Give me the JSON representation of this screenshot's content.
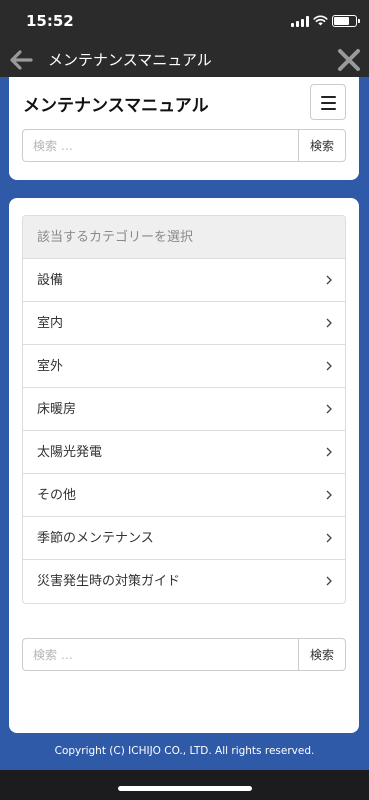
{
  "status_bar": {
    "time": "15:52"
  },
  "nav_bar": {
    "title": "メンテナンスマニュアル"
  },
  "header": {
    "site_title": "メンテナンスマニュアル",
    "search": {
      "placeholder": "検索 …",
      "button_label": "検索"
    }
  },
  "categories": {
    "header": "該当するカテゴリーを選択",
    "items": [
      {
        "label": "設備"
      },
      {
        "label": "室内"
      },
      {
        "label": "室外"
      },
      {
        "label": "床暖房"
      },
      {
        "label": "太陽光発電"
      },
      {
        "label": "その他"
      },
      {
        "label": "季節のメンテナンス"
      },
      {
        "label": "災害発生時の対策ガイド"
      }
    ]
  },
  "bottom_search": {
    "placeholder": "検索 …",
    "button_label": "検索"
  },
  "footer": {
    "copyright": "Copyright (C) ICHIJO CO., LTD. All rights reserved."
  },
  "colors": {
    "page_background": "#2f5aa8",
    "bar_background": "#2b2b2b"
  }
}
